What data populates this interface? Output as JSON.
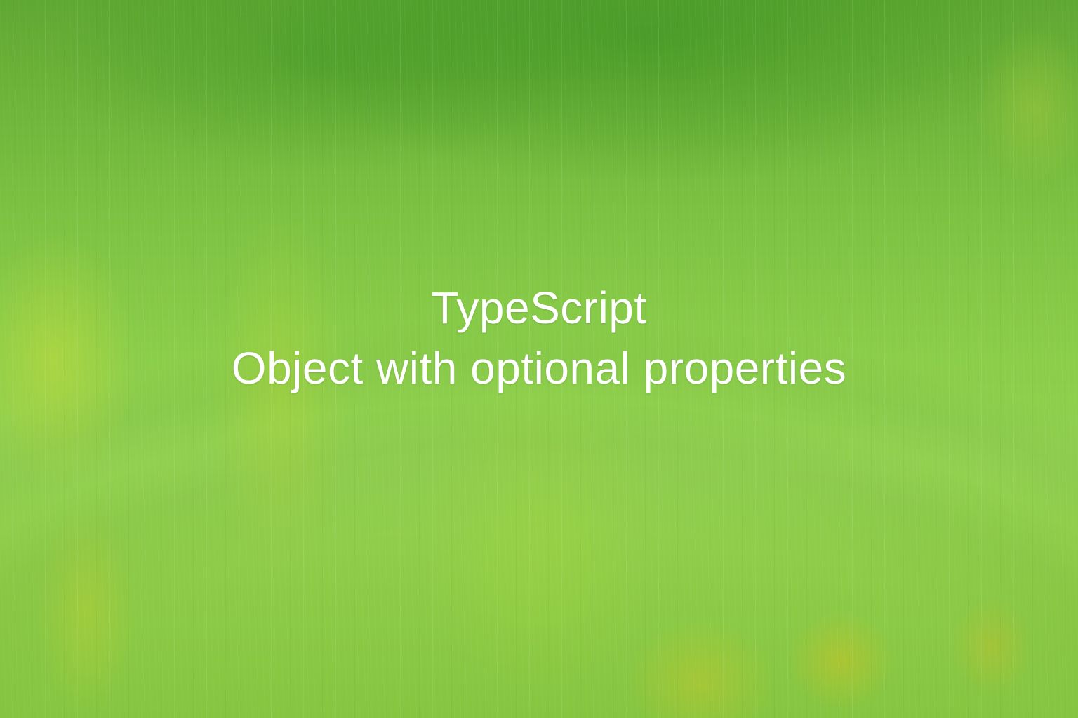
{
  "title": {
    "line1": "TypeScript",
    "line2": "Object with optional properties"
  },
  "colors": {
    "text": "#ffffff",
    "bg_primary": "#7dc242",
    "bg_highlight": "#c8dc3c"
  }
}
